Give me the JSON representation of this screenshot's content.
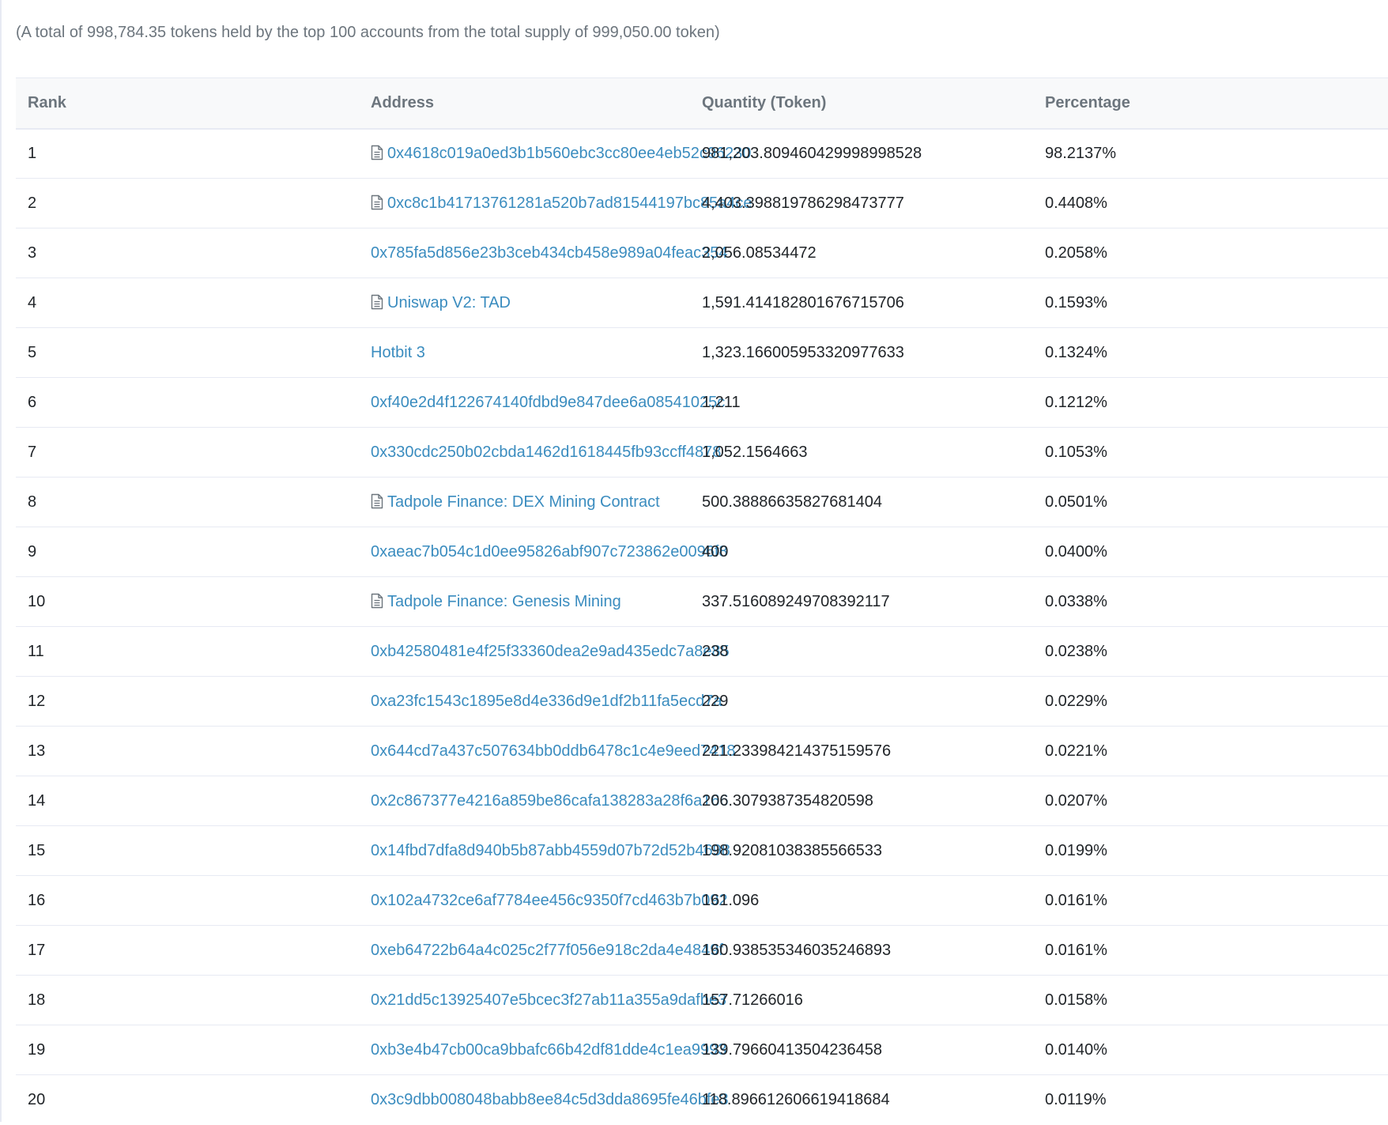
{
  "summary_text": "(A total of 998,784.35 tokens held by the top 100 accounts from the total supply of 999,050.00 token)",
  "table": {
    "headers": {
      "rank": "Rank",
      "address": "Address",
      "quantity": "Quantity (Token)",
      "percentage": "Percentage"
    },
    "rows": [
      {
        "rank": "1",
        "address": "0x4618c019a0ed3b1b560ebc3cc80ee4eb52c96230",
        "contract": true,
        "quantity": "981,203.80946042999899 8528",
        "percentage": "98.2137%"
      },
      {
        "rank": "2",
        "address": "0xc8c1b41713761281a520b7ad81544197bc85a4ce",
        "contract": true,
        "quantity": "4,403.398819786298473777",
        "percentage": "0.4408%"
      },
      {
        "rank": "3",
        "address": "0x785fa5d856e23b3ceb434cb458e989a04feac354",
        "contract": false,
        "quantity": "2,056.08534472",
        "percentage": "0.2058%"
      },
      {
        "rank": "4",
        "address": "Uniswap V2: TAD",
        "contract": true,
        "quantity": "1,591.414182801676715706",
        "percentage": "0.1593%"
      },
      {
        "rank": "5",
        "address": "Hotbit 3",
        "contract": false,
        "quantity": "1,323.166005953320977633",
        "percentage": "0.1324%"
      },
      {
        "rank": "6",
        "address": "0xf40e2d4f122674140fdbd9e847dee6a08541025c",
        "contract": false,
        "quantity": "1,211",
        "percentage": "0.1212%"
      },
      {
        "rank": "7",
        "address": "0x330cdc250b02cbda1462d1618445fb93ccff4878",
        "contract": false,
        "quantity": "1,052.1564663",
        "percentage": "0.1053%"
      },
      {
        "rank": "8",
        "address": "Tadpole Finance: DEX Mining Contract",
        "contract": true,
        "quantity": "500.38886635827681404",
        "percentage": "0.0501%"
      },
      {
        "rank": "9",
        "address": "0xaeac7b054c1d0ee95826abf907c723862e0096f8",
        "contract": false,
        "quantity": "400",
        "percentage": "0.0400%"
      },
      {
        "rank": "10",
        "address": "Tadpole Finance: Genesis Mining",
        "contract": true,
        "quantity": "337.516089249708392117",
        "percentage": "0.0338%"
      },
      {
        "rank": "11",
        "address": "0xb42580481e4f25f33360dea2e9ad435edc7a8e85",
        "contract": false,
        "quantity": "238",
        "percentage": "0.0238%"
      },
      {
        "rank": "12",
        "address": "0xa23fc1543c1895e8d4e336d9e1df2b11fa5ecd7a",
        "contract": false,
        "quantity": "229",
        "percentage": "0.0229%"
      },
      {
        "rank": "13",
        "address": "0x644cd7a437c507634bb0ddb6478c1c4e9eed7418",
        "contract": false,
        "quantity": "221.233984214375159576",
        "percentage": "0.0221%"
      },
      {
        "rank": "14",
        "address": "0x2c867377e4216a859be86cafa138283a28f6a166",
        "contract": false,
        "quantity": "206.3079387354820598",
        "percentage": "0.0207%"
      },
      {
        "rank": "15",
        "address": "0x14fbd7dfa8d940b5b87abb4559d07b72d52b4698",
        "contract": false,
        "quantity": "198.92081038385566533",
        "percentage": "0.0199%"
      },
      {
        "rank": "16",
        "address": "0x102a4732ce6af7784ee456c9350f7cd463b7b092",
        "contract": false,
        "quantity": "161.096",
        "percentage": "0.0161%"
      },
      {
        "rank": "17",
        "address": "0xeb64722b64a4c025c2f77f056e918c2da4e4849f",
        "contract": false,
        "quantity": "160.938535346035246893",
        "percentage": "0.0161%"
      },
      {
        "rank": "18",
        "address": "0x21dd5c13925407e5bcec3f27ab11a355a9dafbe3",
        "contract": false,
        "quantity": "157.71266016",
        "percentage": "0.0158%"
      },
      {
        "rank": "19",
        "address": "0xb3e4b47cb00ca9bbafc66b42df81dde4c1ea9993",
        "contract": false,
        "quantity": "139.79660413504236458",
        "percentage": "0.0140%"
      },
      {
        "rank": "20",
        "address": "0x3c9dbb008048babb8ee84c5d3dda8695fe46bfe3",
        "contract": false,
        "quantity": "118.896612606619418684",
        "percentage": "0.0119%"
      }
    ]
  },
  "colors": {
    "link": "#3a8cbf",
    "header_bg": "#f8f9fa",
    "border": "#e7eaf3",
    "muted_text": "#6c757d"
  },
  "icons": {
    "contract": "file-text-icon"
  }
}
